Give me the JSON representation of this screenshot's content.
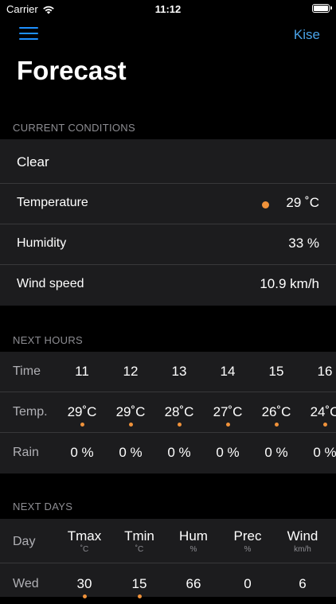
{
  "status": {
    "carrier": "Carrier",
    "time": "11:12"
  },
  "nav": {
    "right_link": "Kise"
  },
  "title": "Forecast",
  "current": {
    "header": "CURRENT CONDITIONS",
    "summary": "Clear",
    "rows": [
      {
        "label": "Temperature",
        "value": "29 ˚C"
      },
      {
        "label": "Humidity",
        "value": "33 %"
      },
      {
        "label": "Wind speed",
        "value": "10.9 km/h"
      }
    ],
    "temp_color": "#f0923a"
  },
  "hours": {
    "header": "NEXT HOURS",
    "time_label": "Time",
    "temp_label": "Temp.",
    "rain_label": "Rain",
    "times": [
      "11",
      "12",
      "13",
      "14",
      "15",
      "16"
    ],
    "temps": [
      "29˚C",
      "29˚C",
      "28˚C",
      "27˚C",
      "26˚C",
      "24˚C"
    ],
    "rain": [
      "0 %",
      "0 %",
      "0 %",
      "0 %",
      "0 %",
      "0 %"
    ],
    "dot_color": "#f0923a"
  },
  "days": {
    "header": "NEXT DAYS",
    "day_label": "Day",
    "columns": [
      {
        "name": "Tmax",
        "unit": "˚C"
      },
      {
        "name": "Tmin",
        "unit": "˚C"
      },
      {
        "name": "Hum",
        "unit": "%"
      },
      {
        "name": "Prec",
        "unit": "%"
      },
      {
        "name": "Wind",
        "unit": "km/h"
      }
    ],
    "rows": [
      {
        "day": "Wed",
        "values": [
          "30",
          "15",
          "66",
          "0",
          "6"
        ]
      }
    ]
  }
}
